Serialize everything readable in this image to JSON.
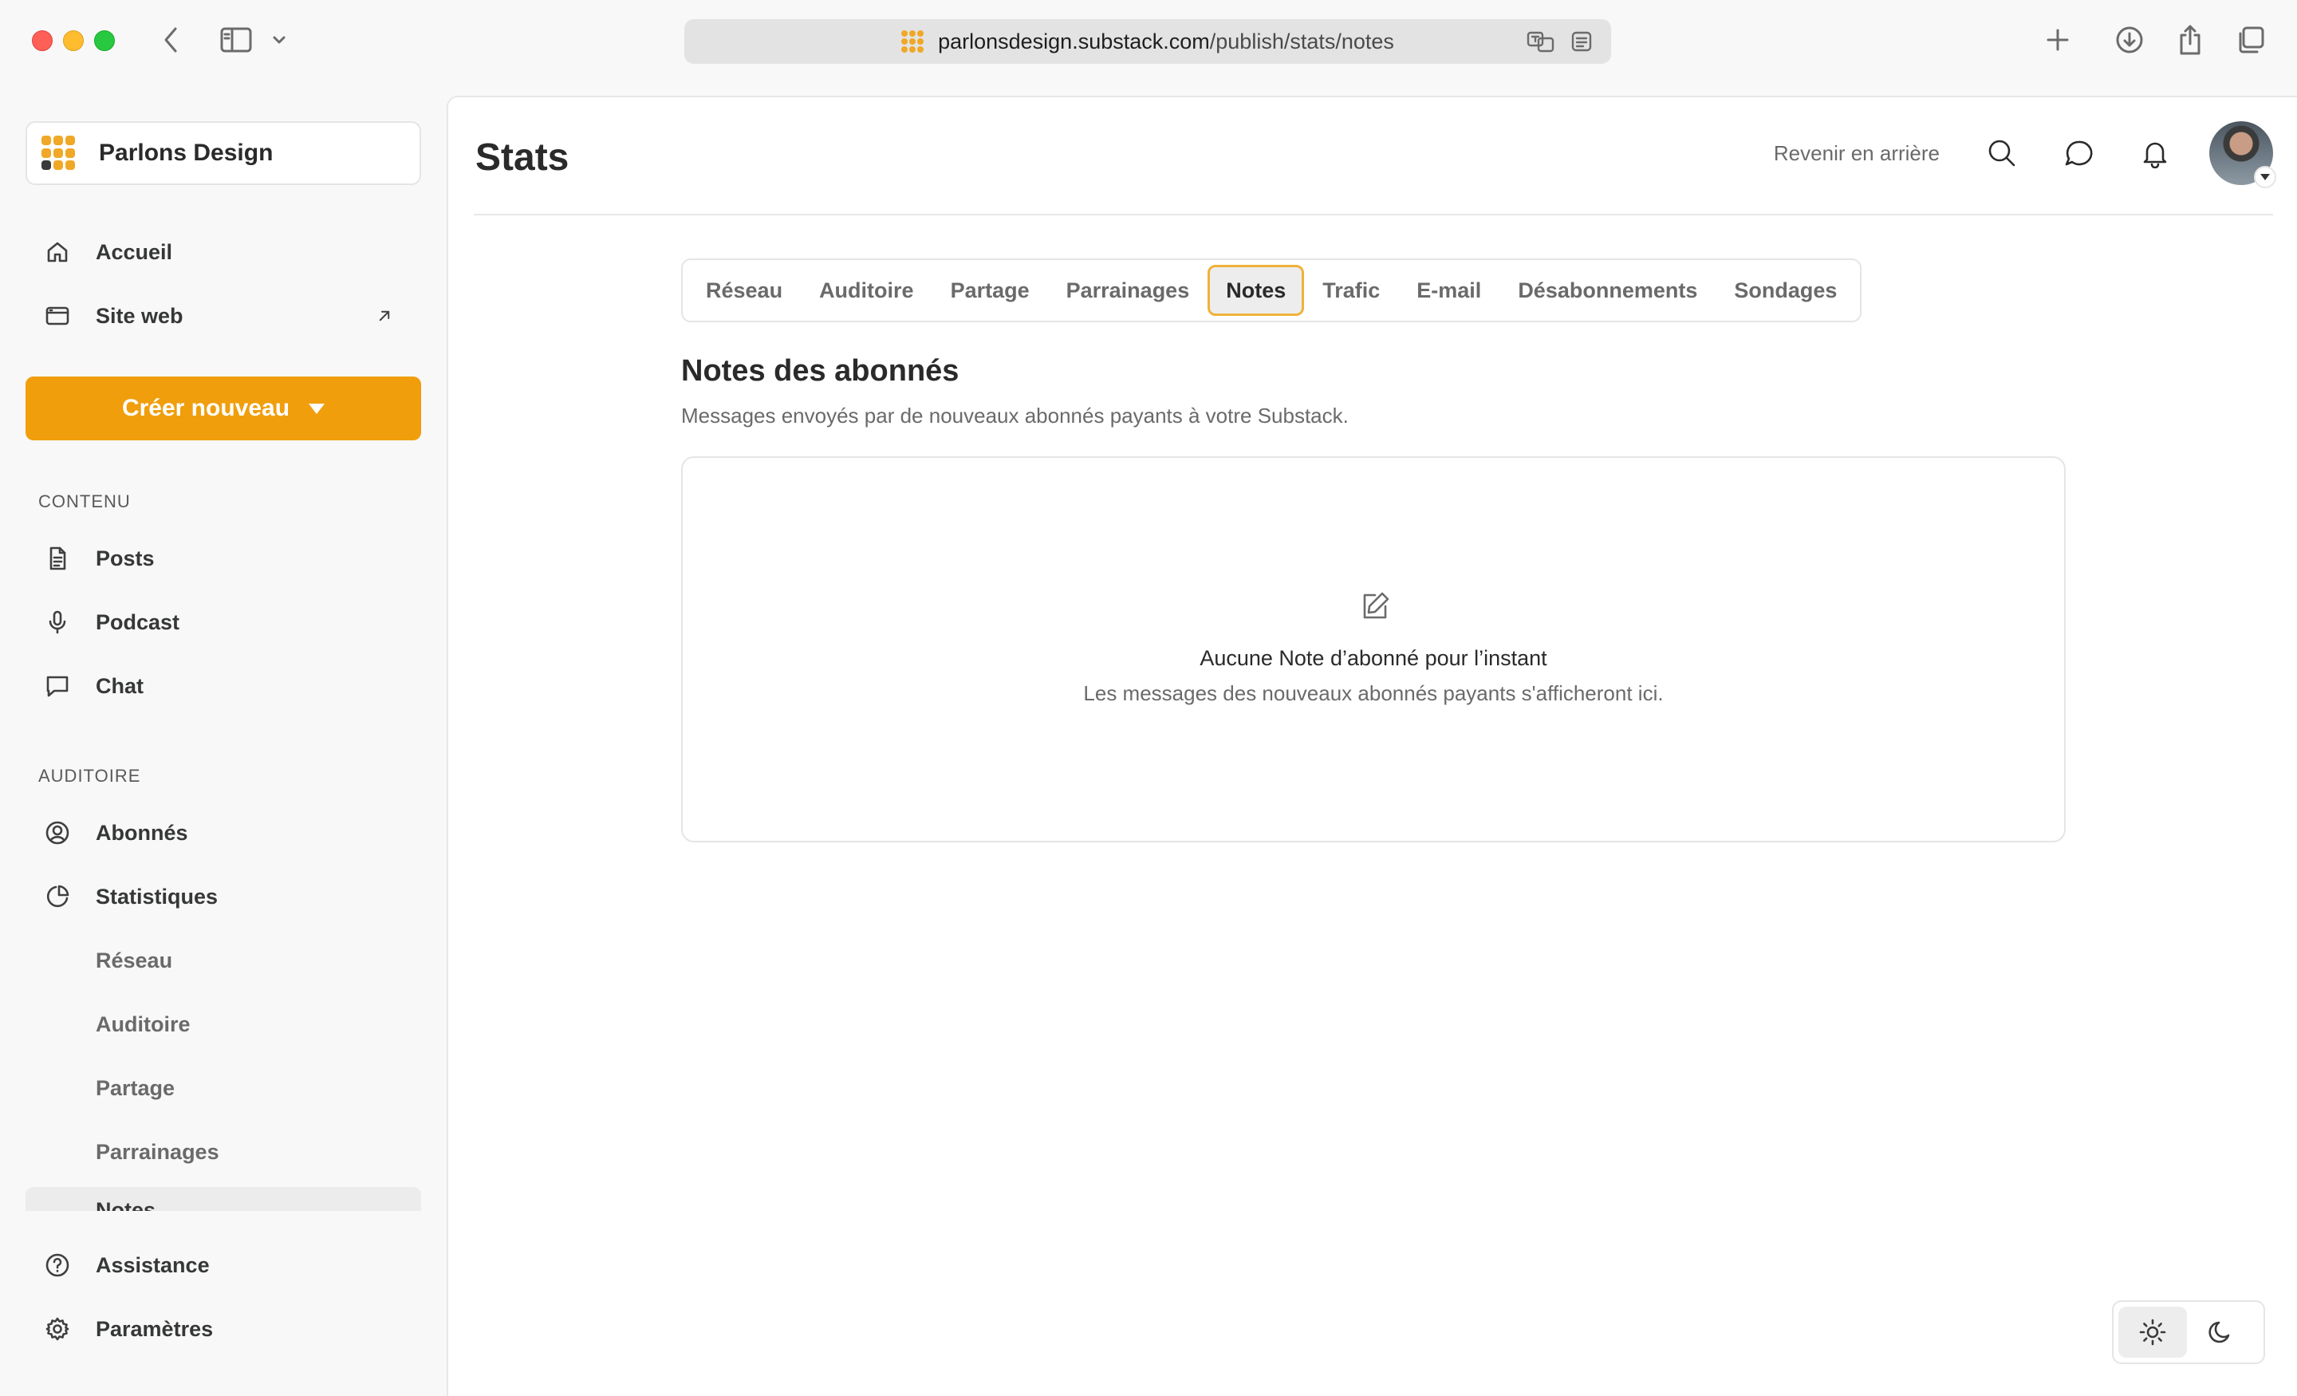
{
  "browser": {
    "url_host": "parlonsdesign.substack.com",
    "url_path": "/publish/stats/notes"
  },
  "sidebar": {
    "publication_name": "Parlons Design",
    "nav": [
      {
        "label": "Accueil",
        "icon": "home-icon"
      },
      {
        "label": "Site web",
        "icon": "browser-window-icon"
      }
    ],
    "create_label": "Créer nouveau",
    "content_section": "CONTENU",
    "content_items": [
      {
        "label": "Posts",
        "icon": "document-icon"
      },
      {
        "label": "Podcast",
        "icon": "microphone-icon"
      },
      {
        "label": "Chat",
        "icon": "chat-bubble-icon"
      }
    ],
    "audience_section": "AUDITOIRE",
    "audience_items": [
      {
        "label": "Abonnés",
        "icon": "user-circle-icon"
      },
      {
        "label": "Statistiques",
        "icon": "pie-chart-icon"
      }
    ],
    "stats_subitems": [
      "Réseau",
      "Auditoire",
      "Partage",
      "Parrainages"
    ],
    "stats_selected_partial": "Notes",
    "footer_items": [
      {
        "label": "Assistance",
        "icon": "help-circle-icon"
      },
      {
        "label": "Paramètres",
        "icon": "gear-icon"
      }
    ]
  },
  "header": {
    "title": "Stats",
    "back_label": "Revenir en arrière"
  },
  "tabs": [
    "Réseau",
    "Auditoire",
    "Partage",
    "Parrainages",
    "Notes",
    "Trafic",
    "E-mail",
    "Désabonnements",
    "Sondages"
  ],
  "active_tab": "Notes",
  "section": {
    "title": "Notes des abonnés",
    "subtitle": "Messages envoyés par de nouveaux abonnés payants à votre Substack."
  },
  "empty_state": {
    "title": "Aucune Note d’abonné pour l’instant",
    "subtitle": "Les messages des nouveaux abonnés payants s'afficheront ici."
  },
  "colors": {
    "accent": "#f09e0c",
    "active_tab_border": "#f0b13b"
  }
}
